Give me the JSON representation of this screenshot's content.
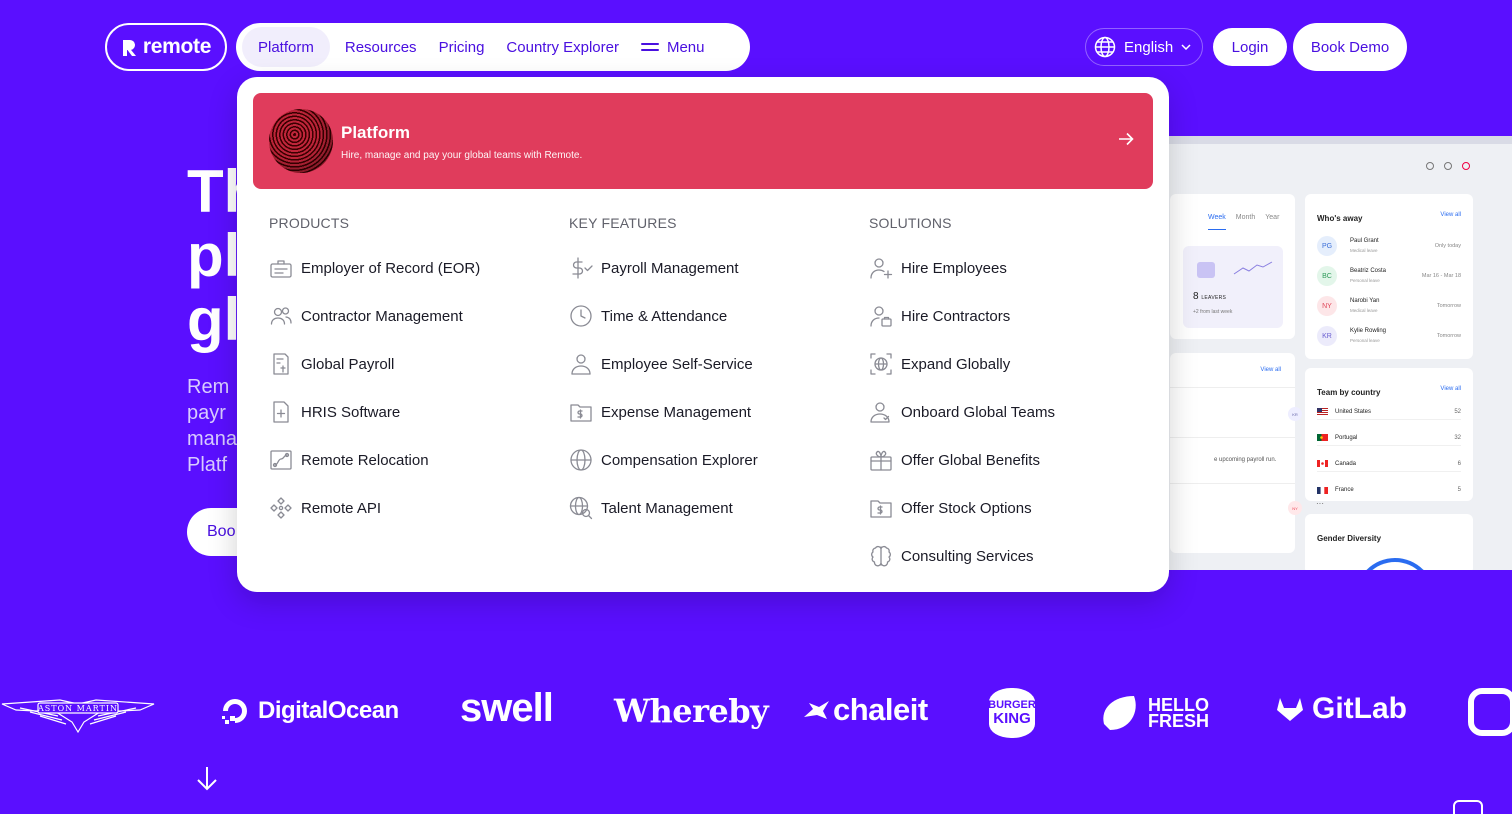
{
  "brand": {
    "name": "remote"
  },
  "nav": {
    "items": [
      {
        "label": "Platform"
      },
      {
        "label": "Resources"
      },
      {
        "label": "Pricing"
      },
      {
        "label": "Country Explorer"
      },
      {
        "label": "Menu"
      }
    ],
    "language": "English",
    "login": "Login",
    "demo": "Book Demo"
  },
  "hero": {
    "heading_visible": "Th\npl\ngl",
    "para_visible": "Rem\npayr\nmana\nPlatf",
    "button_visible": "Boo"
  },
  "mega": {
    "banner": {
      "title": "Platform",
      "subtitle": "Hire, manage and pay your global teams with Remote."
    },
    "columns": [
      {
        "title": "PRODUCTS",
        "items": [
          {
            "label": "Employer of Record (EOR)",
            "icon": "id-badge-icon"
          },
          {
            "label": "Contractor Management",
            "icon": "users-icon"
          },
          {
            "label": "Global Payroll",
            "icon": "receipt-icon"
          },
          {
            "label": "HRIS Software",
            "icon": "document-plus-icon"
          },
          {
            "label": "Remote Relocation",
            "icon": "map-route-icon"
          },
          {
            "label": "Remote API",
            "icon": "api-icon"
          }
        ]
      },
      {
        "title": "KEY FEATURES",
        "items": [
          {
            "label": "Payroll Management",
            "icon": "dollar-check-icon"
          },
          {
            "label": "Time & Attendance",
            "icon": "clock-icon"
          },
          {
            "label": "Employee Self-Service",
            "icon": "user-icon"
          },
          {
            "label": "Expense Management",
            "icon": "folder-dollar-icon"
          },
          {
            "label": "Compensation Explorer",
            "icon": "globe-icon"
          },
          {
            "label": "Talent Management",
            "icon": "globe-search-icon"
          }
        ]
      },
      {
        "title": "SOLUTIONS",
        "items": [
          {
            "label": "Hire Employees",
            "icon": "user-plus-icon"
          },
          {
            "label": "Hire Contractors",
            "icon": "user-briefcase-icon"
          },
          {
            "label": "Expand Globally",
            "icon": "globe-expand-icon"
          },
          {
            "label": "Onboard Global Teams",
            "icon": "user-check-icon"
          },
          {
            "label": "Offer Global Benefits",
            "icon": "gift-icon"
          },
          {
            "label": "Offer Stock Options",
            "icon": "folder-dollar-icon"
          },
          {
            "label": "Consulting Services",
            "icon": "brain-icon"
          }
        ]
      }
    ]
  },
  "dashboard": {
    "tabs": [
      "Week",
      "Month",
      "Year"
    ],
    "leavers": {
      "count": "8",
      "label": "LEAVERS",
      "sub": "+2 from last week"
    },
    "view_all": "View all",
    "upcoming": "e upcoming payroll run.",
    "kr": "KR",
    "ny": "NY",
    "whos_away": {
      "title": "Who's away",
      "rows": [
        {
          "initials": "PG",
          "name": "Paul Grant",
          "type": "Medical leave",
          "when": "Only today",
          "bg": "#e5eefc",
          "fg": "#3b6fd8"
        },
        {
          "initials": "BC",
          "name": "Beatriz Costa",
          "type": "Personal leave",
          "when": "Mar 16 - Mar 18",
          "bg": "#e3f6ea",
          "fg": "#2f9a5a"
        },
        {
          "initials": "NY",
          "name": "Narobi Yan",
          "type": "Medical leave",
          "when": "Tomorrow",
          "bg": "#fde6e8",
          "fg": "#e0485a"
        },
        {
          "initials": "KR",
          "name": "Kylie Rowling",
          "type": "Personal leave",
          "when": "Tomorrow",
          "bg": "#ecebfb",
          "fg": "#6a5fd0"
        }
      ]
    },
    "team_by_country": {
      "title": "Team by country",
      "rows": [
        {
          "country": "United States",
          "count": "52"
        },
        {
          "country": "Portugal",
          "count": "32"
        },
        {
          "country": "Canada",
          "count": "6"
        },
        {
          "country": "France",
          "count": "5"
        }
      ]
    },
    "gender": {
      "title": "Gender Diversity"
    }
  },
  "logos": {
    "aston": "ASTON MARTIN",
    "digitalocean": "DigitalOcean",
    "swell": "swell",
    "whereby": "Whereby",
    "chaleit": "chaleit",
    "bk1": "BURGER",
    "bk2": "KING",
    "hf1": "HELLO",
    "hf2": "FRESH",
    "gitlab": "GitLab"
  },
  "colors": {
    "bg": "#5a0fff",
    "nav_text": "#4a10e0",
    "banner": "#e03c5c"
  }
}
